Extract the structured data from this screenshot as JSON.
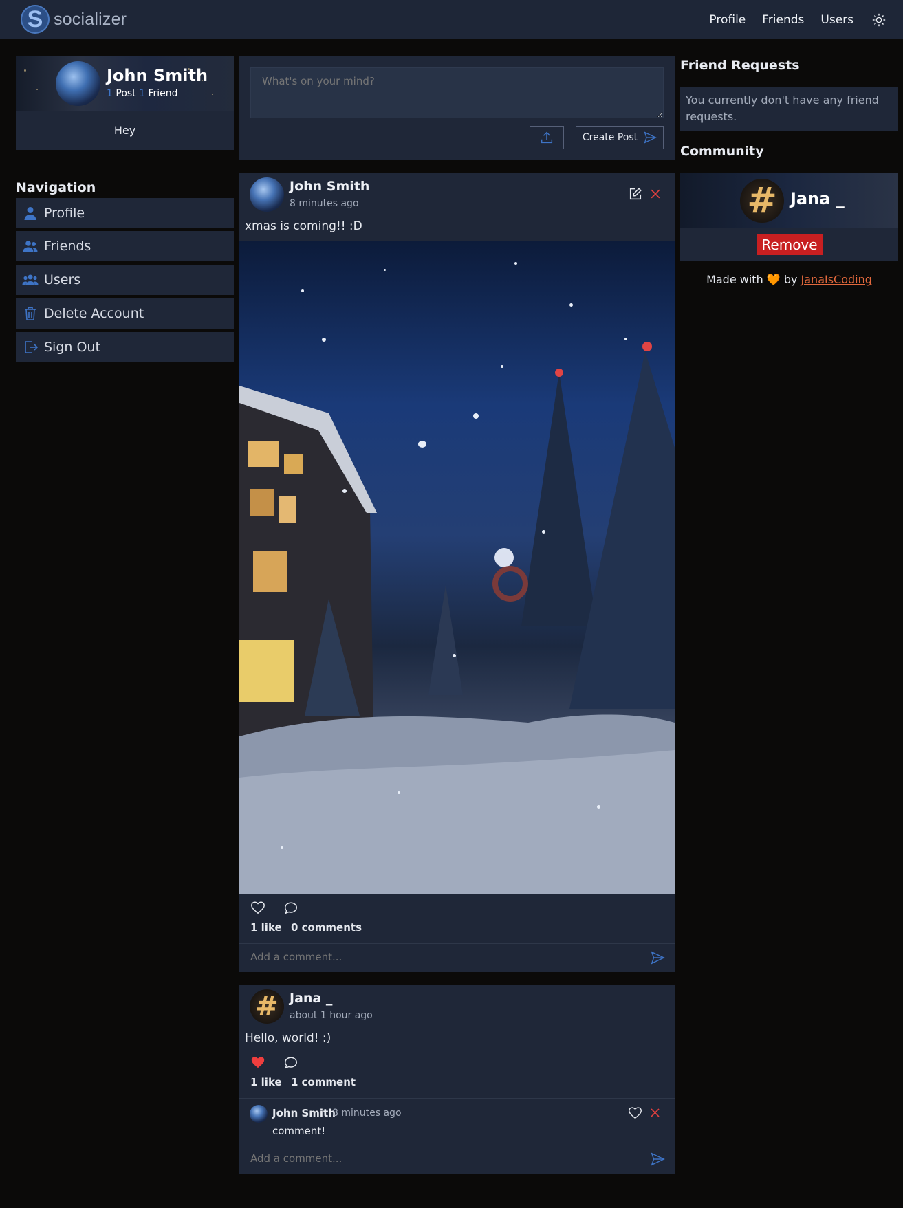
{
  "app": {
    "name": "socializer",
    "logo_letter": "S"
  },
  "topnav": {
    "profile": "Profile",
    "friends": "Friends",
    "users": "Users",
    "theme_icon": "sun-icon"
  },
  "profile": {
    "name": "John Smith",
    "post_count": "1",
    "post_label": "Post",
    "friend_count": "1",
    "friend_label": "Friend",
    "bio": "Hey"
  },
  "navigation": {
    "title": "Navigation",
    "items": [
      {
        "label": "Profile",
        "icon": "user-icon"
      },
      {
        "label": "Friends",
        "icon": "friends-icon"
      },
      {
        "label": "Users",
        "icon": "users-icon"
      },
      {
        "label": "Delete Account",
        "icon": "trash-icon"
      },
      {
        "label": "Sign Out",
        "icon": "sign-out-icon"
      }
    ]
  },
  "composer": {
    "placeholder": "What's on your mind?",
    "create_label": "Create Post"
  },
  "posts": [
    {
      "author": "John Smith",
      "time": "8 minutes ago",
      "text": "xmas is coming!! :D",
      "likes": "1 like",
      "comments": "0 comments",
      "liked": false,
      "comment_placeholder": "Add a comment..."
    },
    {
      "author": "Jana _",
      "time": "about 1 hour ago",
      "text": "Hello, world! :)",
      "likes": "1 like",
      "comments": "1 comment",
      "liked": true,
      "comment_list": [
        {
          "author": "John Smith",
          "time": "8 minutes ago",
          "text": "comment!"
        }
      ],
      "comment_placeholder": "Add a comment..."
    }
  ],
  "friend_requests": {
    "title": "Friend Requests",
    "empty_text": "You currently don't have any friend requests."
  },
  "community": {
    "title": "Community",
    "member": "Jana _",
    "remove_label": "Remove"
  },
  "footer": {
    "made_with": "Made with",
    "heart": "🧡",
    "by": "by",
    "author_link": "JanaIsCoding"
  },
  "colors": {
    "background": "#0b0a09",
    "panel": "#1f2738",
    "accent": "#3e74c6",
    "danger": "#c81f21",
    "link": "#e2683c"
  }
}
